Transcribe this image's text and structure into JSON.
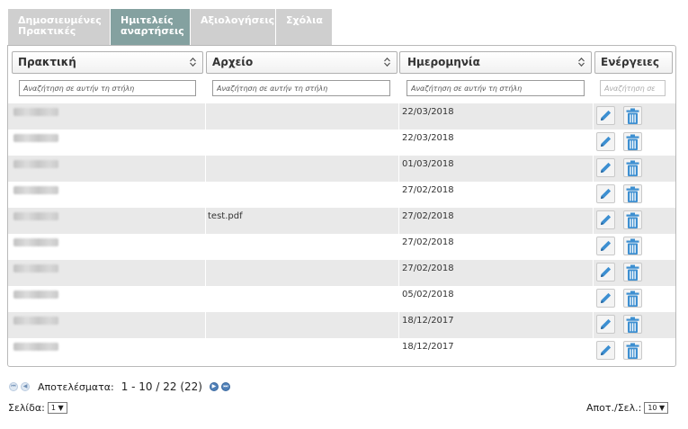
{
  "tabs": [
    {
      "line1": "Δημοσιευμένες",
      "line2": "Πρακτικές"
    },
    {
      "line1": "Ημιτελείς",
      "line2": "αναρτήσεις"
    },
    {
      "line1": "Αξιολογήσεις",
      "line2": ""
    },
    {
      "line1": "Σχόλια",
      "line2": ""
    }
  ],
  "columns": {
    "practice": "Πρακτική",
    "file": "Αρχείο",
    "date": "Ημερομηνία",
    "actions": "Ενέργειες"
  },
  "filters": {
    "placeholder": "Αναζήτηση σε αυτήν τη στήλη",
    "actions_placeholder": "Αναζήτηση σε"
  },
  "rows": [
    {
      "file": "",
      "date": "22/03/2018"
    },
    {
      "file": "",
      "date": "22/03/2018"
    },
    {
      "file": "",
      "date": "01/03/2018"
    },
    {
      "file": "",
      "date": "27/02/2018"
    },
    {
      "file": "test.pdf",
      "date": "27/02/2018"
    },
    {
      "file": "",
      "date": "27/02/2018"
    },
    {
      "file": "",
      "date": "27/02/2018"
    },
    {
      "file": "",
      "date": "05/02/2018"
    },
    {
      "file": "",
      "date": "18/12/2017"
    },
    {
      "file": "",
      "date": "18/12/2017"
    }
  ],
  "pager": {
    "results_label": "Αποτελέσματα:",
    "range": "1 - 10 / 22 (22)",
    "page_label": "Σελίδα:",
    "page_value": "1",
    "per_page_label": "Αποτ./Σελ.:",
    "per_page_value": "10",
    "arrow": "▼"
  },
  "colors": {
    "active_tab": "#84a1a0",
    "inactive_tab": "#cfcfcf",
    "action_icon": "#3d8fd1"
  },
  "icons": {
    "edit": "pencil-icon",
    "delete": "trash-icon"
  }
}
